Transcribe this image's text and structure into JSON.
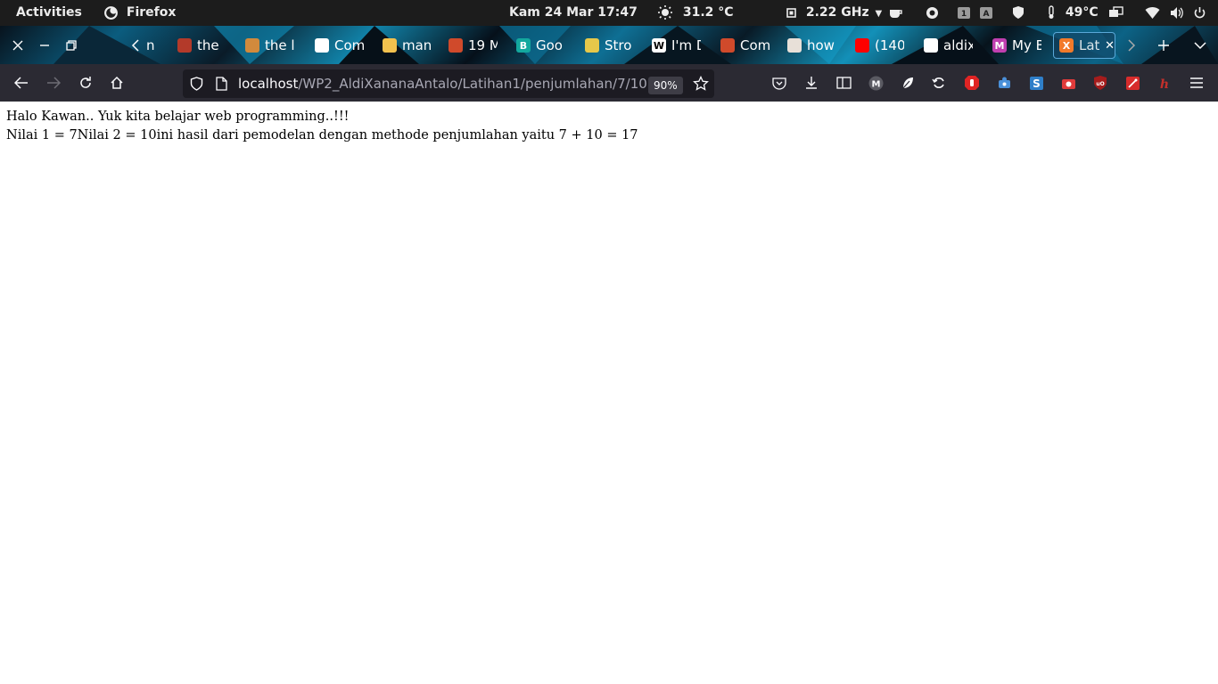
{
  "system": {
    "activities_label": "Activities",
    "app_label": "Firefox",
    "clock": "Kam 24 Mar  17:47",
    "weather": "31.2 °C",
    "cpu_freq": "2.22 GHz",
    "temperature": "49°C"
  },
  "tabs": [
    {
      "label": "n",
      "fav_color": "#000000",
      "fav_text": ""
    },
    {
      "label": "the",
      "fav_color": "#b33a2a",
      "fav_text": ""
    },
    {
      "label": "the l",
      "fav_color": "#d18a3c",
      "fav_text": ""
    },
    {
      "label": "Com",
      "fav_color": "#ffffff",
      "fav_text": ""
    },
    {
      "label": "man",
      "fav_color": "#f2c14e",
      "fav_text": ""
    },
    {
      "label": "19 M",
      "fav_color": "#d04a2b",
      "fav_text": ""
    },
    {
      "label": "Goo",
      "fav_color": "#13a89e",
      "fav_text": "B"
    },
    {
      "label": "Stro",
      "fav_color": "#e6c84a",
      "fav_text": ""
    },
    {
      "label": "I'm D",
      "fav_color": "#ffffff",
      "fav_text": "W"
    },
    {
      "label": "Com",
      "fav_color": "#d04a2b",
      "fav_text": ""
    },
    {
      "label": "how",
      "fav_color": "#e8e0d8",
      "fav_text": ""
    },
    {
      "label": "(140",
      "fav_color": "#ff0000",
      "fav_text": ""
    },
    {
      "label": "aldix",
      "fav_color": "#ffffff",
      "fav_text": ""
    },
    {
      "label": "My B",
      "fav_color": "#c03fb0",
      "fav_text": "M"
    },
    {
      "label": "Lat",
      "fav_color": "#f27a2a",
      "fav_text": "X"
    }
  ],
  "url": {
    "host": "localhost",
    "path": "/WP2_AldiXananaAntalo/Latihan1/penjumlahan/7/10",
    "zoom": "90%"
  },
  "page": {
    "line1": "Halo Kawan.. Yuk kita belajar web programming..!!!",
    "line2": "Nilai 1 = 7Nilai 2 = 10ini hasil dari pemodelan dengan methode penjumlahan yaitu 7 + 10 = 17"
  },
  "colors": {
    "topbar": "#1c1c1c",
    "navbar": "#2b2a33",
    "urlbar": "#1c1b22"
  }
}
